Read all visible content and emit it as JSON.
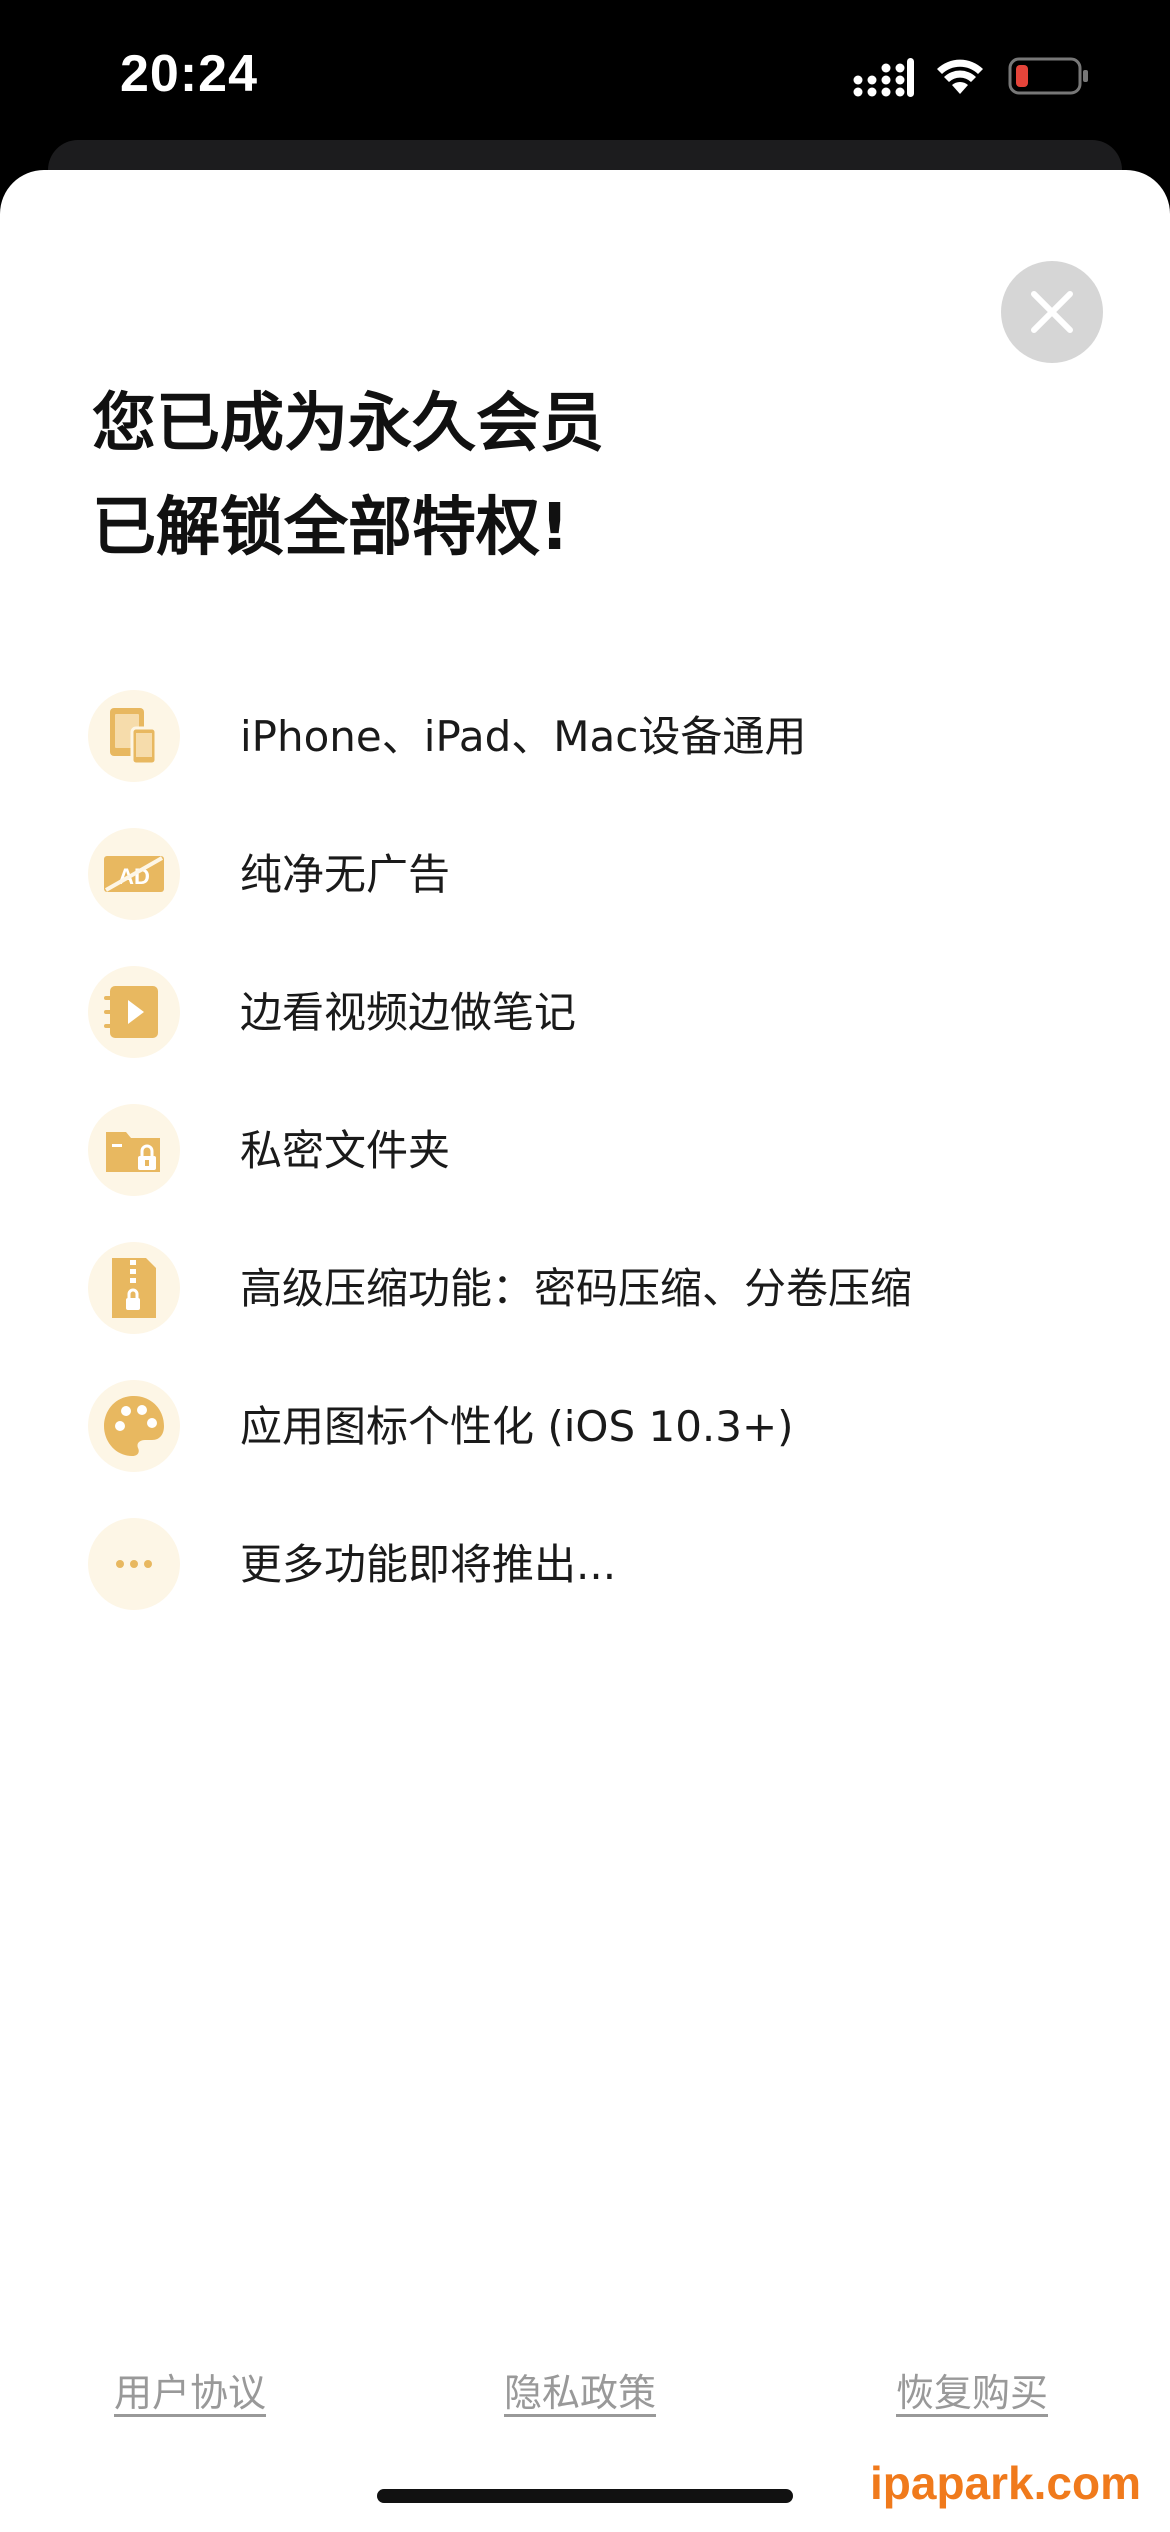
{
  "status_bar": {
    "time": "20:24",
    "icons": [
      "signal-icon",
      "wifi-icon",
      "battery-low-icon"
    ]
  },
  "sheet": {
    "close_icon": "close-icon",
    "title_line1": "您已成为永久会员",
    "title_line2": "已解锁全部特权!"
  },
  "features": [
    {
      "icon": "devices-icon",
      "label": "iPhone、iPad、Mac设备通用"
    },
    {
      "icon": "no-ads-icon",
      "label": "纯净无广告"
    },
    {
      "icon": "video-note-icon",
      "label": "边看视频边做笔记"
    },
    {
      "icon": "private-folder-icon",
      "label": "私密文件夹"
    },
    {
      "icon": "zip-lock-icon",
      "label": "高级压缩功能：密码压缩、分卷压缩"
    },
    {
      "icon": "palette-icon",
      "label": "应用图标个性化 (iOS 10.3+)"
    },
    {
      "icon": "more-icon",
      "label": "更多功能即将推出..."
    }
  ],
  "footer": {
    "user_agreement": "用户协议",
    "privacy_policy": "隐私政策",
    "restore_purchase": "恢复购买"
  },
  "watermark": "ipapark.com",
  "colors": {
    "accent": "#E8B860",
    "icon_bg": "#FDF6E6",
    "battery_low": "#E5443A",
    "footer_link": "#999999"
  }
}
